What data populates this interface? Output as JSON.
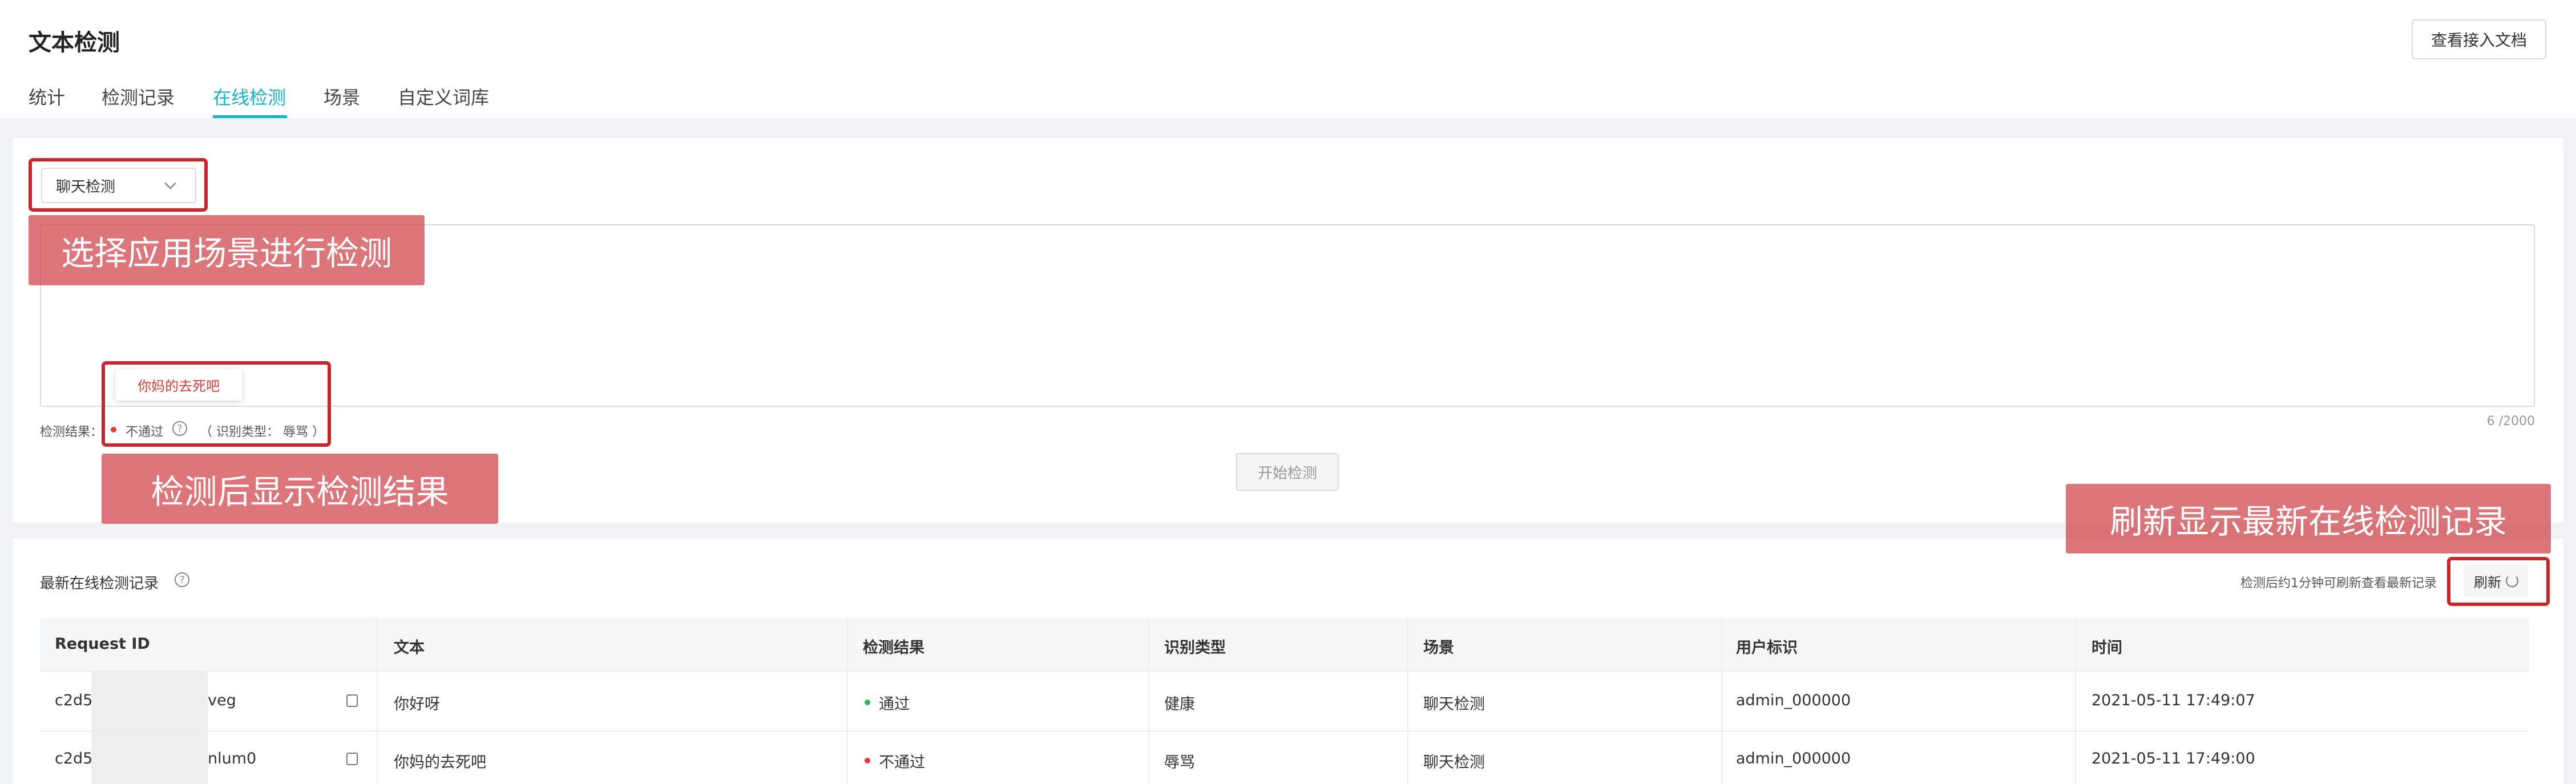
{
  "header": {
    "title": "文本检测",
    "doc_button": "查看接入文档",
    "tabs": [
      {
        "label": "统计",
        "active": false
      },
      {
        "label": "检测记录",
        "active": false
      },
      {
        "label": "在线检测",
        "active": true
      },
      {
        "label": "场景",
        "active": false
      },
      {
        "label": "自定义词库",
        "active": false
      }
    ],
    "accent_color": "#13b5c5"
  },
  "detect": {
    "scene_select_value": "聊天检测",
    "char_counter": "6 /2000",
    "result_label": "检测结果：",
    "result_status": "不通过",
    "result_type": "（ 识别类型： 辱骂 ）",
    "tooltip_text": "你妈的去死吧",
    "start_button": "开始检测"
  },
  "records": {
    "title": "最新在线检测记录",
    "hint": "检测后约1分钟可刷新查看最新记录",
    "refresh_button": "刷新",
    "columns": [
      "Request ID",
      "文本",
      "检测结果",
      "识别类型",
      "场景",
      "用户标识",
      "时间"
    ],
    "rows": [
      {
        "request_id_prefix": "c2d5",
        "request_id_suffix": "veg",
        "text": "你好呀",
        "result": "通过",
        "result_color": "#2eb85c",
        "type": "健康",
        "scene": "聊天检测",
        "user": "admin_000000",
        "time": "2021-05-11 17:49:07"
      },
      {
        "request_id_prefix": "c2d5",
        "request_id_suffix": "nlum0",
        "text": "你妈的去死吧",
        "result": "不通过",
        "result_color": "#e53935",
        "type": "辱骂",
        "scene": "聊天检测",
        "user": "admin_000000",
        "time": "2021-05-11 17:49:00"
      }
    ]
  },
  "annotations": {
    "select_scene": "选择应用场景进行检测",
    "result_display": "检测后显示检测结果",
    "refresh_records": "刷新显示最新在线检测记录",
    "highlight_color": "#c8262c"
  }
}
